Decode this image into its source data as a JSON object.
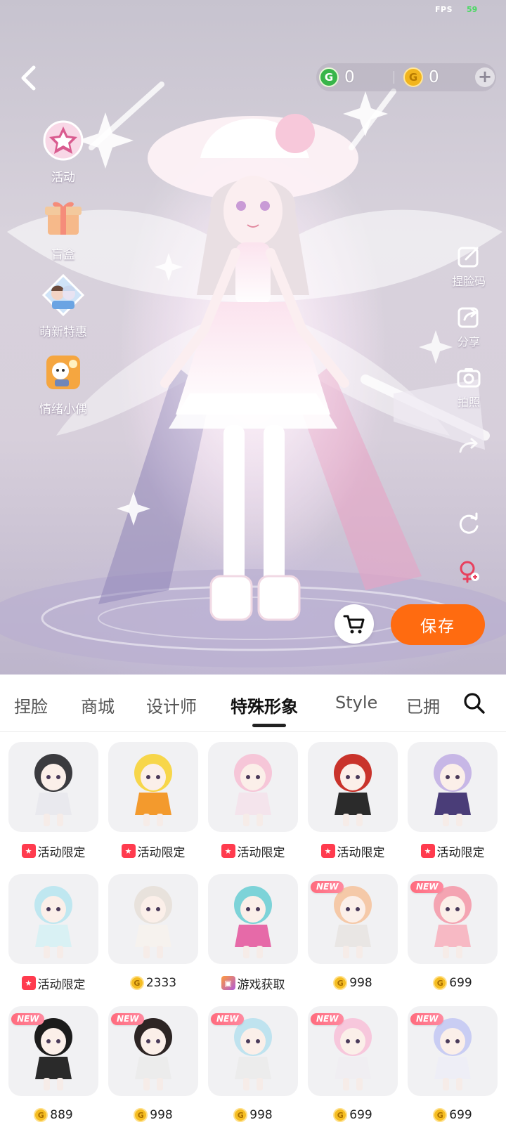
{
  "status": {
    "fps_label": "FPS",
    "fps_value": "59"
  },
  "header": {
    "green_currency": {
      "icon": "g-coin-icon",
      "amount": "0"
    },
    "gold_currency": {
      "icon": "gold-coin-icon",
      "amount": "0"
    },
    "add_symbol": "+"
  },
  "left_menu": [
    {
      "label": "活动",
      "icon": "event-star-icon"
    },
    {
      "label": "盲盒",
      "icon": "gift-box-icon"
    },
    {
      "label": "萌新特惠",
      "icon": "newbie-deal-icon"
    },
    {
      "label": "情绪小偶",
      "icon": "emotion-doll-icon"
    }
  ],
  "right_menu": [
    {
      "label": "捏脸码",
      "icon": "face-code-icon"
    },
    {
      "label": "分享",
      "icon": "share-icon"
    },
    {
      "label": "拍照",
      "icon": "camera-icon"
    },
    {
      "label": "",
      "icon": "redo-icon"
    },
    {
      "label": "",
      "icon": "rotate-icon"
    },
    {
      "label": "",
      "icon": "gender-swap-icon"
    }
  ],
  "actions": {
    "save_label": "保存",
    "cart_icon": "cart-icon"
  },
  "tabs": [
    {
      "label": "捏脸",
      "active": false
    },
    {
      "label": "商城",
      "active": false
    },
    {
      "label": "设计师",
      "active": false
    },
    {
      "label": "特殊形象",
      "active": true
    },
    {
      "label": "Style",
      "active": false
    },
    {
      "label": "已拥",
      "active": false
    }
  ],
  "new_badge_text": "NEW",
  "items": [
    {
      "price_type": "limited",
      "price": "活动限定",
      "new": false,
      "palette": [
        "#3b3b3f",
        "#e9e9ee"
      ]
    },
    {
      "price_type": "limited",
      "price": "活动限定",
      "new": false,
      "palette": [
        "#f7d64a",
        "#f39a2d"
      ]
    },
    {
      "price_type": "limited",
      "price": "活动限定",
      "new": false,
      "palette": [
        "#f6c6d8",
        "#f4e4ec"
      ]
    },
    {
      "price_type": "limited",
      "price": "活动限定",
      "new": false,
      "palette": [
        "#c9332b",
        "#2b2b2b"
      ]
    },
    {
      "price_type": "limited",
      "price": "活动限定",
      "new": false,
      "palette": [
        "#c7b7e6",
        "#4a3d78"
      ]
    },
    {
      "price_type": "limited",
      "price": "活动限定",
      "new": false,
      "palette": [
        "#bfe7f0",
        "#d9f1f4"
      ]
    },
    {
      "price_type": "coin",
      "price": "2333",
      "new": false,
      "palette": [
        "#e8e2dc",
        "#f6f2ee"
      ]
    },
    {
      "price_type": "game",
      "price": "游戏获取",
      "new": false,
      "palette": [
        "#7dd3d8",
        "#e66aa8"
      ]
    },
    {
      "price_type": "coin",
      "price": "998",
      "new": true,
      "palette": [
        "#f5c9a8",
        "#e9e6e4"
      ]
    },
    {
      "price_type": "coin",
      "price": "699",
      "new": true,
      "palette": [
        "#f4a4b2",
        "#f7b9c4"
      ]
    },
    {
      "price_type": "coin",
      "price": "889",
      "new": true,
      "palette": [
        "#1c1c1c",
        "#2a2a2a"
      ]
    },
    {
      "price_type": "coin",
      "price": "998",
      "new": true,
      "palette": [
        "#2d2524",
        "#ececec"
      ]
    },
    {
      "price_type": "coin",
      "price": "998",
      "new": true,
      "palette": [
        "#bfe3ef",
        "#ececec"
      ]
    },
    {
      "price_type": "coin",
      "price": "699",
      "new": true,
      "palette": [
        "#f7c7dc",
        "#f0eef2"
      ]
    },
    {
      "price_type": "coin",
      "price": "699",
      "new": true,
      "palette": [
        "#c9cdf3",
        "#eeeef6"
      ]
    }
  ]
}
